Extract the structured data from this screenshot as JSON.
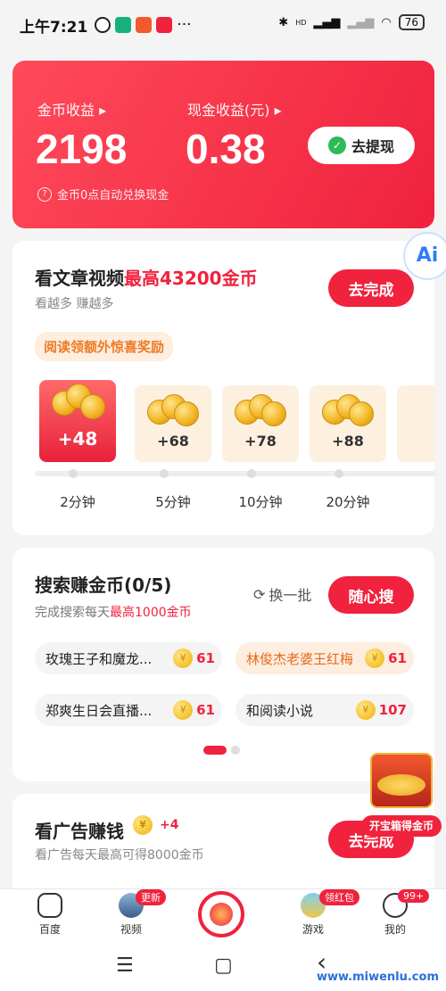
{
  "status": {
    "time": "上午7:21",
    "battery": "76",
    "more": "···",
    "hd": "HD"
  },
  "earnings": {
    "coin_label": "金币收益",
    "coin_value": "2198",
    "cash_label": "现金收益(元)",
    "cash_value": "0.38",
    "withdraw_label": "去提现",
    "note": "金币0点自动兑换现金",
    "accent": "#f0223d"
  },
  "articles": {
    "title": "看文章视频",
    "title_highlight": "最高43200金币",
    "subtitle": "看越多 赚越多",
    "button": "去完成",
    "promo": "阅读领额外惊喜奖励",
    "rewards": [
      "+48",
      "+68",
      "+78",
      "+88"
    ],
    "times": [
      "2分钟",
      "5分钟",
      "10分钟",
      "20分钟"
    ]
  },
  "search": {
    "title": "搜索赚金币(0/5)",
    "subtitle_prefix": "完成搜索每天",
    "subtitle_highlight": "最高1000金币",
    "shuffle": "换一批",
    "button": "随心搜",
    "chips": [
      {
        "text": "玫瑰王子和魔龙...",
        "coins": "61"
      },
      {
        "text": "林俊杰老婆王红梅",
        "coins": "61"
      },
      {
        "text": "郑爽生日会直播...",
        "coins": "61"
      },
      {
        "text": "和阅读小说",
        "coins": "107"
      }
    ],
    "coin_symbol": "¥"
  },
  "ads": {
    "title": "看广告赚钱",
    "bonus": "+4",
    "subtitle": "看广告每天最高可得8000金币",
    "button": "去完成"
  },
  "floating": {
    "ai": "Ai",
    "treasure": "开宝箱得金币"
  },
  "nav": {
    "items": [
      {
        "label": "百度"
      },
      {
        "label": "视频",
        "badge": "更新"
      },
      {
        "label": "游戏",
        "badge": "领红包"
      },
      {
        "label": "我的",
        "badge": "99+"
      }
    ]
  },
  "system": {
    "menu": "☰",
    "home": "▢",
    "back": "‹",
    "watermark": "www.miwenlu.com"
  }
}
